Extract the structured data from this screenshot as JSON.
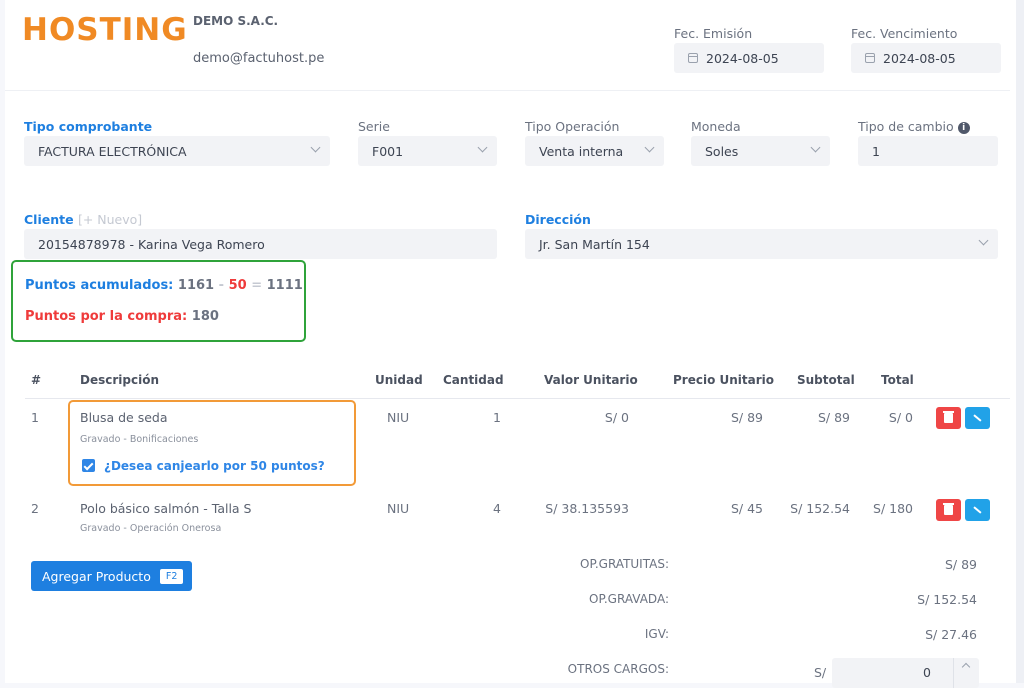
{
  "header": {
    "logo": "HOSTING",
    "company": "DEMO S.A.C.",
    "email": "demo@factuhost.pe",
    "fec_emision_label": "Fec. Emisión",
    "fec_emision": "2024-08-05",
    "fec_vencimiento_label": "Fec. Vencimiento",
    "fec_vencimiento": "2024-08-05"
  },
  "form": {
    "tipo_comprobante_label": "Tipo comprobante",
    "tipo_comprobante": "FACTURA ELECTRÓNICA",
    "serie_label": "Serie",
    "serie": "F001",
    "tipo_operacion_label": "Tipo Operación",
    "tipo_operacion": "Venta interna",
    "moneda_label": "Moneda",
    "moneda": "Soles",
    "tipo_cambio_label": "Tipo de cambio",
    "tipo_cambio": "1",
    "cliente_label": "Cliente",
    "nuevo_link": "[+ Nuevo]",
    "cliente": "20154878978 - Karina Vega Romero",
    "direccion_label": "Dirección",
    "direccion": "Jr. San Martín 154"
  },
  "points": {
    "acumulados_label": "Puntos acumulados:",
    "acumulados": "1161",
    "minus": "-",
    "canje": "50",
    "equals": "=",
    "resultado": "1111",
    "compra_label": "Puntos por la compra:",
    "compra": "180"
  },
  "table": {
    "headers": [
      "#",
      "Descripción",
      "Unidad",
      "Cantidad",
      "Valor Unitario",
      "Precio Unitario",
      "Subtotal",
      "Total"
    ],
    "rows": [
      {
        "num": "1",
        "desc": "Blusa de seda",
        "sub": "Gravado - Bonificaciones",
        "unidad": "NIU",
        "cantidad": "1",
        "valor_unitario": "S/ 0",
        "precio_unitario": "S/ 89",
        "subtotal": "S/ 89",
        "total": "S/ 0"
      },
      {
        "num": "2",
        "desc": "Polo básico salmón - Talla S",
        "sub": "Gravado - Operación Onerosa",
        "unidad": "NIU",
        "cantidad": "4",
        "valor_unitario": "S/ 38.135593",
        "precio_unitario": "S/ 45",
        "subtotal": "S/ 152.54",
        "total": "S/ 180"
      }
    ],
    "canje_question": "¿Desea canjearlo por 50 puntos?",
    "canje_checked": true
  },
  "actions": {
    "add_product": "Agregar Producto",
    "add_shortcut": "F2"
  },
  "totals": {
    "op_gratuitas_label": "OP.GRATUITAS:",
    "op_gratuitas": "S/ 89",
    "op_gravada_label": "OP.GRAVADA:",
    "op_gravada": "S/ 152.54",
    "igv_label": "IGV:",
    "igv": "S/ 27.46",
    "otros_cargos_label": "OTROS CARGOS:",
    "otros_cargos_currency": "S/",
    "otros_cargos": "0"
  },
  "colors": {
    "accent": "#1e7fe0",
    "logo": "#f08a24",
    "danger": "#ef4646",
    "points_border": "#2fa33a",
    "product_border": "#f29a38"
  }
}
